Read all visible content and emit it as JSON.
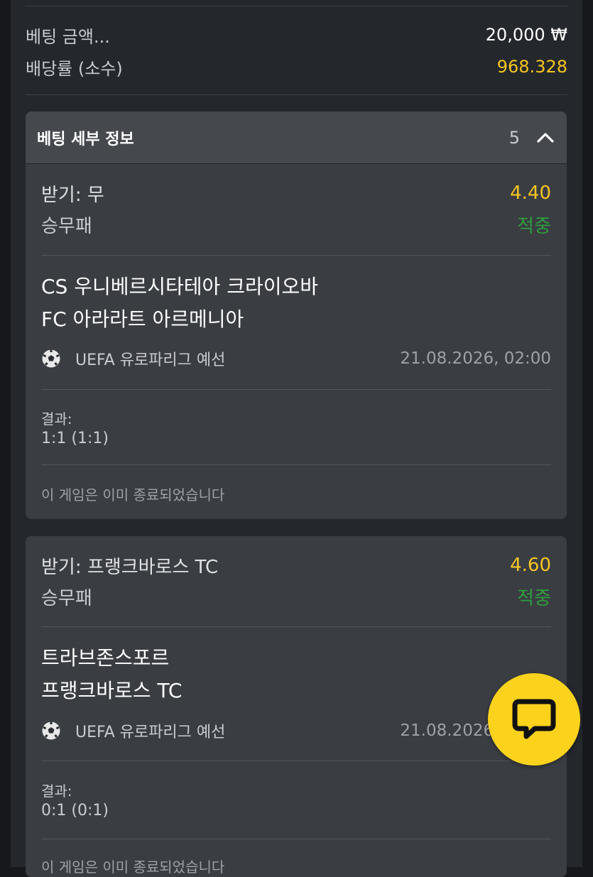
{
  "summary": {
    "bet_amount_label": "베팅 금액...",
    "bet_amount_value": "20,000 ₩",
    "odds_label": "배당률 (소수)",
    "odds_value": "968.328"
  },
  "details": {
    "title": "베팅 세부 정보",
    "count": "5",
    "toggle_icon": "chevron-up-icon"
  },
  "bets": [
    {
      "pick": "받기: 무",
      "odds": "4.40",
      "market": "승무패",
      "status": "적중",
      "home_team": "CS 우니베르시타테아 크라이오바",
      "away_team": "FC 아라라트 아르메니아",
      "sport_icon": "soccer-ball-icon",
      "league": "UEFA 유로파리그 예선",
      "datetime": "21.08.2026, 02:00",
      "result_label": "결과:",
      "result": "1:1 (1:1)",
      "note": "이 게임은 이미 종료되었습니다"
    },
    {
      "pick": "받기: 프랭크바로스 TC",
      "odds": "4.60",
      "market": "승무패",
      "status": "적중",
      "home_team": "트라브존스포르",
      "away_team": "프랭크바로스 TC",
      "sport_icon": "soccer-ball-icon",
      "league": "UEFA 유로파리그 예선",
      "datetime": "21.08.2026, 02:00",
      "result_label": "결과:",
      "result": "0:1 (0:1)",
      "note": "이 게임은 이미 종료되었습니다"
    }
  ],
  "chat_button": {
    "icon": "chat-bubble-icon"
  },
  "colors": {
    "accent_yellow": "#f6c521",
    "win_green": "#2e9e3e",
    "panel_bg": "#24272b",
    "card_bg": "#3a3d42"
  }
}
